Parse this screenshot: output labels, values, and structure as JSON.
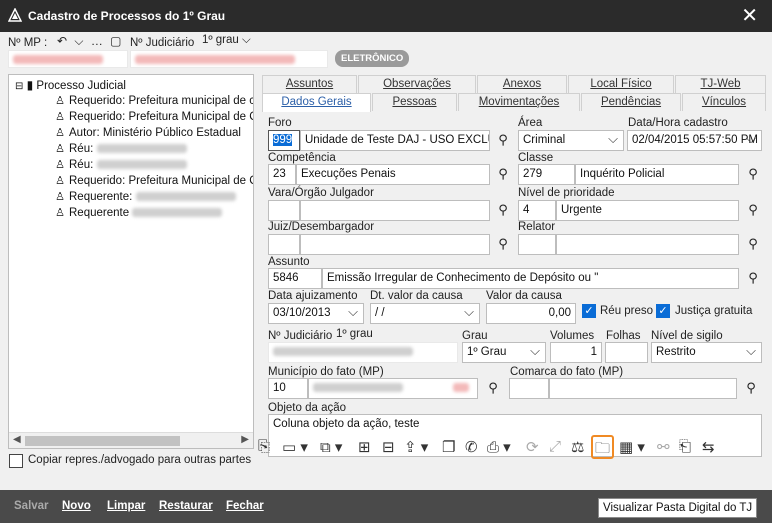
{
  "window": {
    "title": "Cadastro de Processos do 1º Grau"
  },
  "top": {
    "nmp_label": "Nº MP :",
    "nav_symbols": "↶ ⌵ … ▢",
    "njud_label": "Nº Judiciário",
    "grau_select": "1º grau",
    "badge": "ELETRÔNICO"
  },
  "tree": {
    "root": "Processo Judicial",
    "items": [
      "Requerido: Prefeitura municipal de c",
      "Requerido: Prefeitura Municipal de C",
      "Autor: Ministério Público Estadual",
      "Réu:",
      "Réu:",
      "Requerido: Prefeitura Municipal de C",
      "Requerente:",
      "Requerente"
    ]
  },
  "copy_checkbox": "Copiar repres./advogado para outras partes",
  "tabs_row1": [
    "Assuntos",
    "Observações",
    "Anexos",
    "Local Físico",
    "TJ-Web"
  ],
  "tabs_row2": [
    "Dados Gerais",
    "Pessoas",
    "Movimentações",
    "Pendências",
    "Vínculos"
  ],
  "form": {
    "foro_label": "Foro",
    "foro_code": "999",
    "foro_name": "Unidade de Teste DAJ - USO EXCLUS",
    "area_label": "Área",
    "area_value": "Criminal",
    "data_cadastro_label": "Data/Hora cadastro",
    "data_cadastro_value": "02/04/2015 05:57:50 PM",
    "competencia_label": "Competência",
    "competencia_code": "23",
    "competencia_name": "Execuções Penais",
    "classe_label": "Classe",
    "classe_code": "279",
    "classe_name": "Inquérito Policial",
    "vara_label": "Vara/Órgão Julgador",
    "nivel_prioridade_label": "Nível de prioridade",
    "prioridade_code": "4",
    "prioridade_name": "Urgente",
    "juiz_label": "Juiz/Desembargador",
    "relator_label": "Relator",
    "assunto_label": "Assunto",
    "assunto_code": "5846",
    "assunto_name": "Emissão Irregular de Conhecimento de Depósito ou \"",
    "data_ajuizamento_label": "Data ajuizamento",
    "data_ajuizamento_value": "03/10/2013",
    "dt_valor_label": "Dt. valor da causa",
    "dt_valor_value": "/ /",
    "valor_causa_label": "Valor da causa",
    "valor_causa_value": "0,00",
    "reu_preso_label": "Réu preso",
    "justica_gratuita_label": "Justiça gratuita",
    "njud_label": "Nº Judiciário",
    "njud_grau": "1º grau",
    "grau_label": "Grau",
    "grau_value": "1º Grau",
    "volumes_label": "Volumes",
    "volumes_value": "1",
    "folhas_label": "Folhas",
    "sigilo_label": "Nível de sigilo",
    "sigilo_value": "Restrito",
    "municipio_label": "Município do fato (MP)",
    "municipio_code": "10",
    "comarca_label": "Comarca do fato (MP)",
    "objeto_label": "Objeto da ação",
    "objeto_value": "Coluna objeto da ação, teste"
  },
  "tooltip": "Visualizar Pasta Digital do TJ",
  "bottom_buttons": [
    "Salvar",
    "Novo",
    "Limpar",
    "Restaurar",
    "Fechar"
  ],
  "colors": {
    "titlebar": "#2b2b2b",
    "accent": "#0a6cd6",
    "highlight": "#f08a24"
  }
}
